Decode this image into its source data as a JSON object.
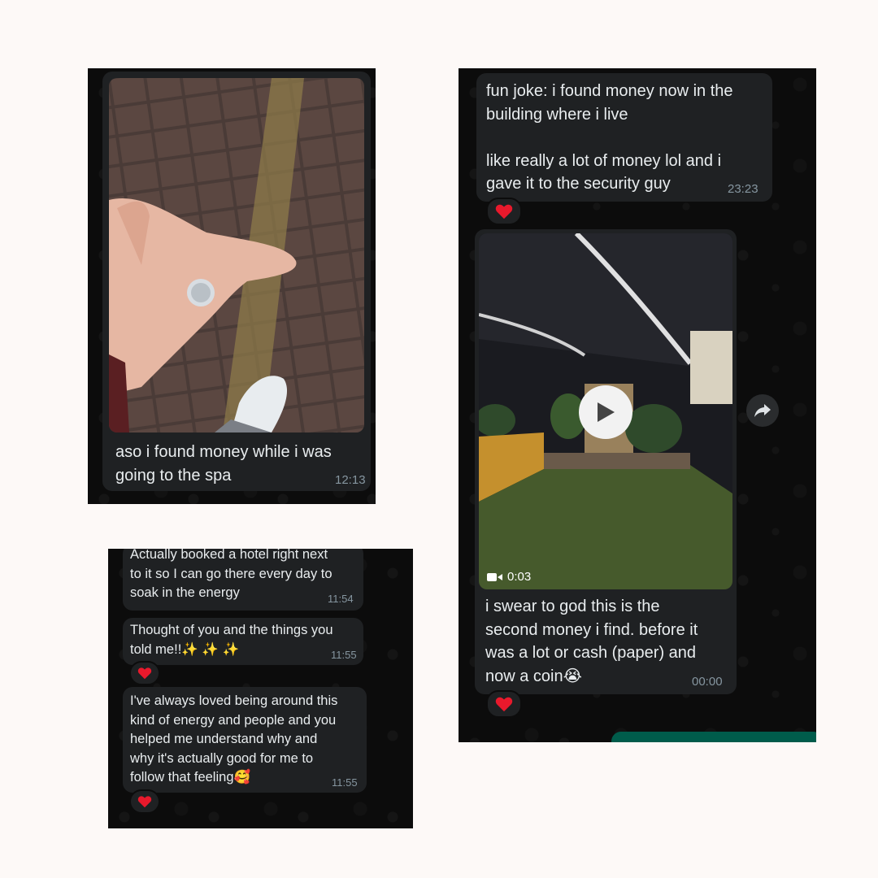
{
  "panel_left": {
    "message_text": "aso i found money while i was\ngoing to the spa",
    "time": "12:13",
    "photo_alt": "coin-in-hand-photo"
  },
  "panel_right": {
    "message_1": {
      "text": "fun joke: i found money now in the\nbuilding where i live\n\nlike really a lot of money lol and i\ngave it to the security guy",
      "time": "23:23",
      "reaction": "❤️"
    },
    "video_message": {
      "duration": "0:03",
      "text": "i swear to god this is the\nsecond money i find. before it\nwas a lot or cash (paper) and\nnow a coin😭",
      "time": "00:00",
      "reaction": "❤️"
    }
  },
  "panel_bottom": {
    "message_1": {
      "text": "Actually booked a hotel right next\nto it so I can go there every day to\nsoak in the energy",
      "time": "11:54"
    },
    "message_2": {
      "text": "Thought of you and the things you\ntold me!!✨ ✨ ✨",
      "time": "11:55",
      "reaction": "❤️"
    },
    "message_3": {
      "text": "I've always loved being around this\nkind of energy and people and you\nhelped me understand why and\nwhy it's actually good for me to\nfollow that feeling🥰",
      "time": "11:55",
      "reaction": "❤️"
    }
  },
  "colors": {
    "page_bg": "#fdf9f7",
    "chat_bg": "#0c0c0c",
    "bubble_bg": "#1f2123",
    "text": "#e9edef",
    "timestamp": "#8696a0",
    "outgoing_bubble": "#005c4b",
    "heart": "#e8192c"
  }
}
